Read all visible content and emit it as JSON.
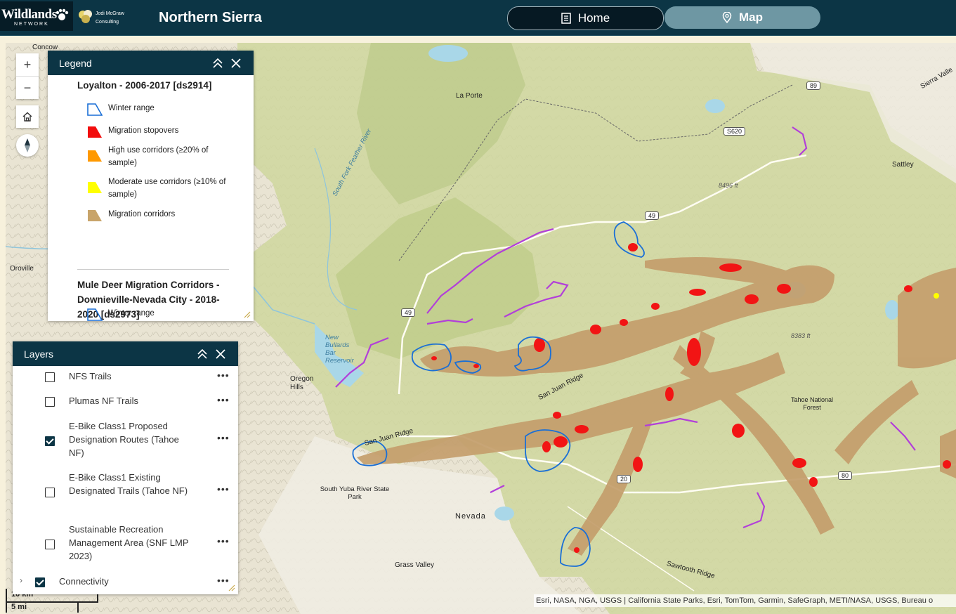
{
  "header": {
    "logo_text": "Wildlands",
    "logo_subtext": "NETWORK",
    "partner_line1": "Jodi McGraw",
    "partner_line2": "Consulting",
    "title": "Northern Sierra",
    "nav": [
      {
        "label": "Home",
        "icon": "document-icon",
        "active": false
      },
      {
        "label": "Map",
        "icon": "map-pin-icon",
        "active": true
      }
    ],
    "colors": {
      "bar": "#0c3545",
      "active_tab": "#6e97a3"
    }
  },
  "map_tools": {
    "zoom_in": "+",
    "zoom_out": "−",
    "home_icon": "home-icon",
    "compass_icon": "compass-icon"
  },
  "legend": {
    "title": "Legend",
    "section1_title": "Loyalton - 2006-2017 [ds2914]",
    "items": [
      {
        "label": "Winter range",
        "symbol": "outline",
        "color": "#1a6fd6"
      },
      {
        "label": "Migration stopovers",
        "symbol": "fill",
        "color": "#f20d0d"
      },
      {
        "label": "High use corridors (≥20% of sample)",
        "symbol": "fill",
        "color": "#ff9900"
      },
      {
        "label": "Moderate use corridors (≥10% of sample)",
        "symbol": "fill",
        "color": "#ffff00"
      },
      {
        "label": "Migration corridors",
        "symbol": "fill",
        "color": "#c8a46a"
      }
    ],
    "section2_title": "Mule Deer Migration Corridors - Downieville-Nevada City - 2018-2020 [ds2973]",
    "section2_items": [
      {
        "label": "Winter range",
        "symbol": "outline",
        "color": "#1a6fd6"
      }
    ]
  },
  "layers": {
    "title": "Layers",
    "items": [
      {
        "label": "NFS Trails",
        "checked": false
      },
      {
        "label": "Plumas NF Trails",
        "checked": false
      },
      {
        "label": "E-Bike Class1 Proposed Designation Routes (Tahoe NF)",
        "checked": true
      },
      {
        "label": "E-Bike Class1 Existing Designated Trails (Tahoe NF)",
        "checked": false
      },
      {
        "label": "Sustainable Recreation Management Area (SNF LMP 2023)",
        "checked": false
      },
      {
        "label": "Connectivity",
        "checked": true,
        "expandable": true
      }
    ],
    "more_label": "•••"
  },
  "map": {
    "places": {
      "concow": "Concow",
      "la_porte": "La Porte",
      "oroville": "Oroville",
      "oregon_hills": "Oregon Hills",
      "sattley": "Sattley",
      "sierra_valley": "Sierra Valle",
      "tahoe_nf": "Tahoe National Forest",
      "south_yuba": "South Yuba River State Park",
      "nevada": "Nevada",
      "grass_valley": "Grass Valley",
      "san_juan_ridge1": "San Juan Ridge",
      "san_juan_ridge2": "San Juan Ridge",
      "sawtooth_ridge": "Sawtooth Ridge",
      "new_bullards": "New Bullards Bar Reservoir",
      "south_fork": "South Fork Feather River",
      "peak1": "8496 ft",
      "peak2": "8383 ft"
    },
    "route_shields": [
      "89",
      "S620",
      "49",
      "49",
      "80",
      "20"
    ],
    "attribution": "Esri, NASA, NGA, USGS | California State Parks, Esri, TomTom, Garmin, SafeGraph, METI/NASA, USGS, Bureau o",
    "scale_km": "10 km",
    "scale_mi": "5 mi"
  }
}
